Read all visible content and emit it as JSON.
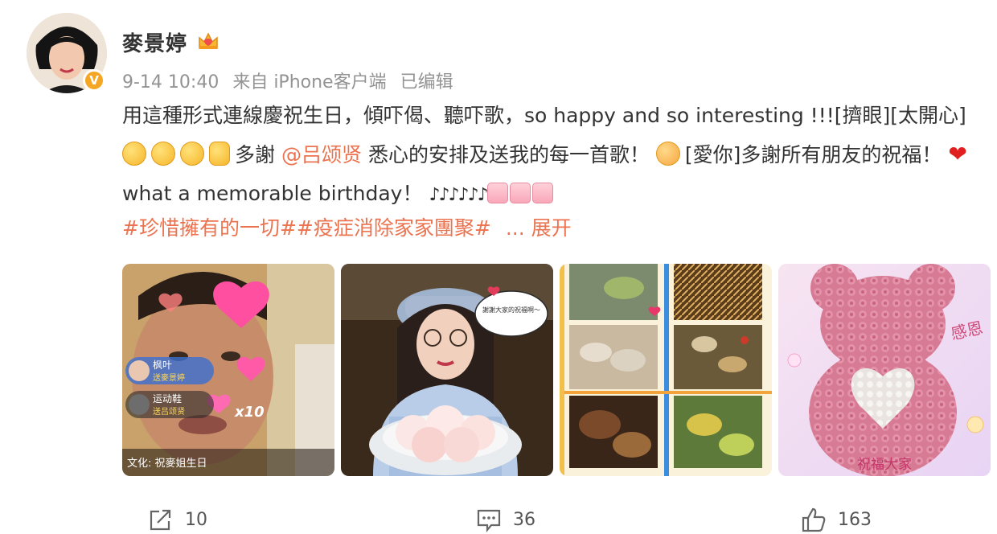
{
  "post": {
    "author": "麥景婷",
    "author_badge_icon": "crown-icon",
    "verified_mark": "V",
    "time": "9-14 10:40",
    "source": "来自 iPhone客户端",
    "edited": "已编辑",
    "text_part1": "用這種形式連線慶祝生日，傾吓偈、聽吓歌，so happy and so interesting !!![擠眼][太開心]",
    "text_part2": "多謝",
    "mention": "@吕颂贤",
    "text_part3": "悉心的安排及送我的每一首歌！",
    "text_part4": "[愛你]多謝所有朋友的祝福！",
    "text_part5": "what a memorable birthday！",
    "notes": "♪♪♪♪♪♪",
    "topic1": "#珍惜擁有的一切#",
    "topic2": "#疫症消除家家團聚#",
    "more": "... 展开"
  },
  "photos": {
    "photo1": {
      "bubble1_name": "枫叶",
      "bubble1_sub": "送麥景婷",
      "bubble2_name": "运动鞋",
      "bubble2_sub": "送吕颂贤",
      "multiplier": "x10",
      "caption": "文化: 祝麥姐生日"
    },
    "photo2": {
      "bubble": "謝謝大家的祝福啊～"
    },
    "photo4": {
      "text_right": "感恩",
      "text_bottom": "祝福大家"
    }
  },
  "actions": {
    "repost_count": "10",
    "comment_count": "36",
    "like_count": "163"
  },
  "colors": {
    "link": "#eb7350",
    "text": "#333333",
    "meta": "#939393",
    "verified": "#f5a623"
  }
}
